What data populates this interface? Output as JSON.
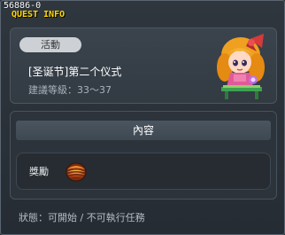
{
  "quest": {
    "id": "56886-0",
    "window_title": "QUEST INFO",
    "category_badge": "活動",
    "name": "[圣诞节]第二个仪式",
    "recommended_level": "建議等級：33～37"
  },
  "content": {
    "header": "內容",
    "reward_label": "獎勵",
    "reward_icon": "reward-item-icon"
  },
  "status": "狀態：可開始 / 不可執行任務",
  "colors": {
    "title": "#ffd800",
    "badge_bg": "#cdd1d5"
  }
}
